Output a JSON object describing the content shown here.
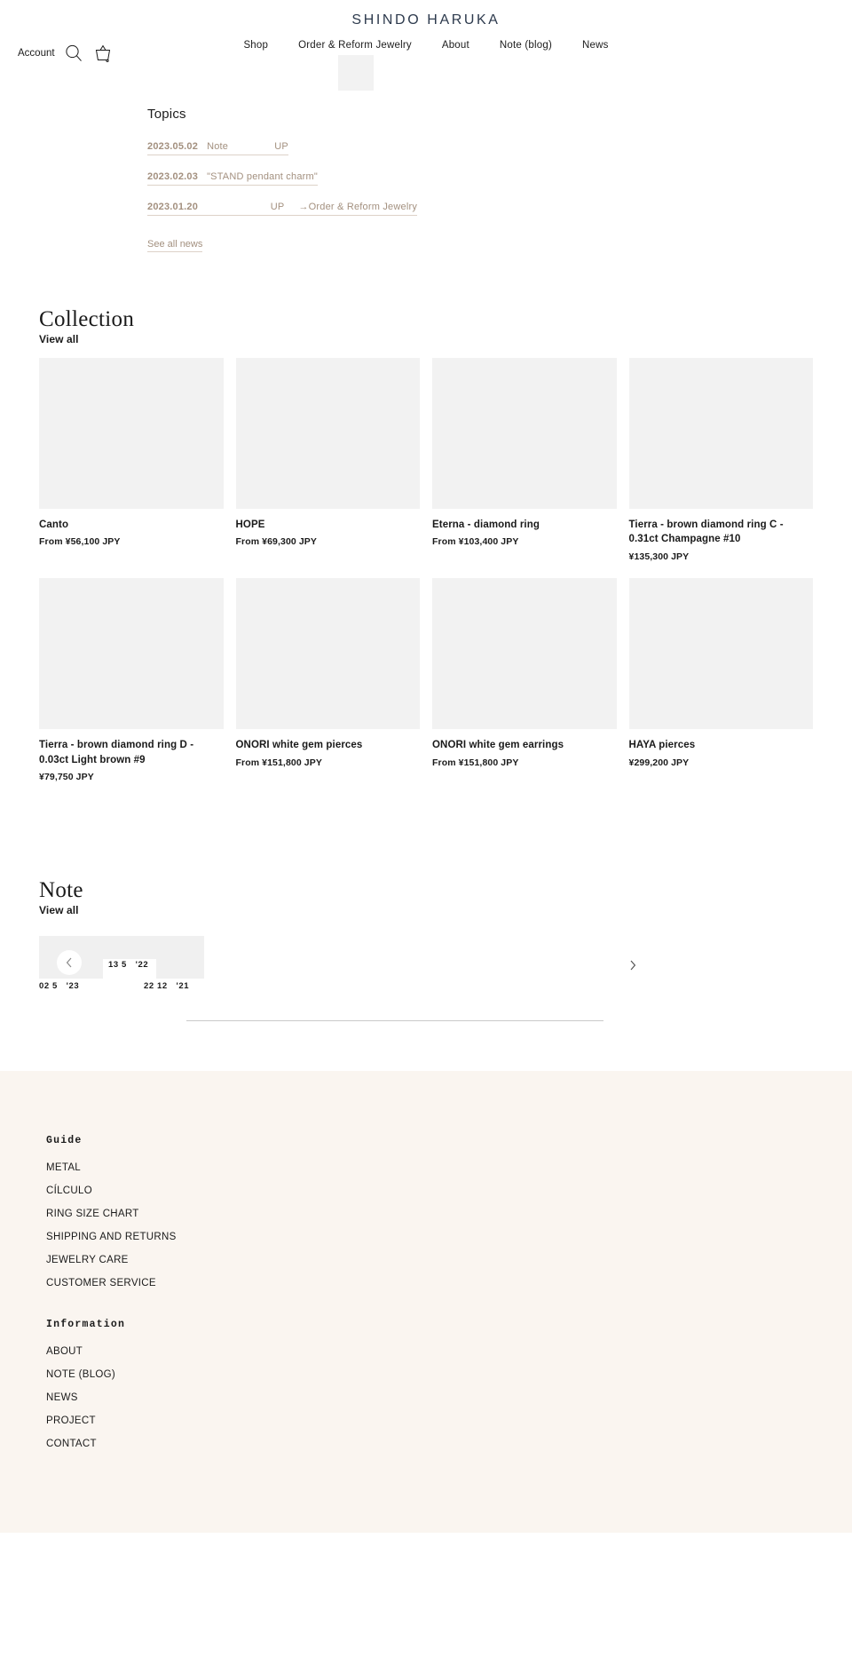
{
  "header": {
    "brand": "SHINDO HARUKA",
    "nav": [
      {
        "label": "Shop"
      },
      {
        "label": "Order & Reform Jewelry"
      },
      {
        "label": "About"
      },
      {
        "label": "Note (blog)"
      },
      {
        "label": "News"
      }
    ],
    "account_label": "Account",
    "search_icon": "search-icon",
    "cart_icon": "shopping-basket-icon"
  },
  "topics": {
    "title": "Topics",
    "items": [
      {
        "date": "2023.05.02",
        "text": "Note                UP"
      },
      {
        "date": "2023.02.03",
        "text": "\"STAND pendant charm\""
      },
      {
        "date": "2023.01.20",
        "text": "                      UP     →Order & Reform Jewelry"
      }
    ],
    "see_all": "See all news"
  },
  "collection": {
    "title": "Collection",
    "view_all": "View all",
    "products": [
      {
        "name": "Canto",
        "price": "From ¥56,100 JPY"
      },
      {
        "name": "HOPE",
        "price": "From ¥69,300 JPY"
      },
      {
        "name": "Eterna - diamond ring",
        "price": "From ¥103,400 JPY"
      },
      {
        "name": "Tierra - brown diamond ring C - 0.31ct Champagne #10",
        "price": "¥135,300 JPY"
      },
      {
        "name": "Tierra - brown diamond ring D - 0.03ct Light brown #9",
        "price": "¥79,750 JPY"
      },
      {
        "name": "ONORI white gem pierces",
        "price": "From ¥151,800 JPY"
      },
      {
        "name": "ONORI white gem earrings",
        "price": "From ¥151,800 JPY"
      },
      {
        "name": "HAYA pierces",
        "price": "¥299,200 JPY"
      }
    ]
  },
  "note": {
    "title": "Note",
    "view_all": "View all",
    "prev_icon": "chevron-left-icon",
    "next_icon": "chevron-right-icon",
    "dates": [
      {
        "label": "02 5   '23"
      },
      {
        "label": "13 5   '22"
      },
      {
        "label": "22 12   '21"
      }
    ]
  },
  "footer": {
    "groups": [
      {
        "heading": "Guide",
        "links": [
          "METAL",
          "CÍLCULO",
          "RING SIZE CHART",
          "SHIPPING AND RETURNS",
          "JEWELRY CARE",
          "CUSTOMER SERVICE"
        ]
      },
      {
        "heading": "Information",
        "links": [
          "ABOUT",
          "NOTE (BLOG)",
          "NEWS",
          "PROJECT",
          "CONTACT"
        ]
      }
    ]
  },
  "colors": {
    "brand_navy": "#2d3a4d",
    "topic_brown": "#a3907f",
    "placeholder_gray": "#f2f2f2",
    "footer_bg": "#faf5f0"
  }
}
